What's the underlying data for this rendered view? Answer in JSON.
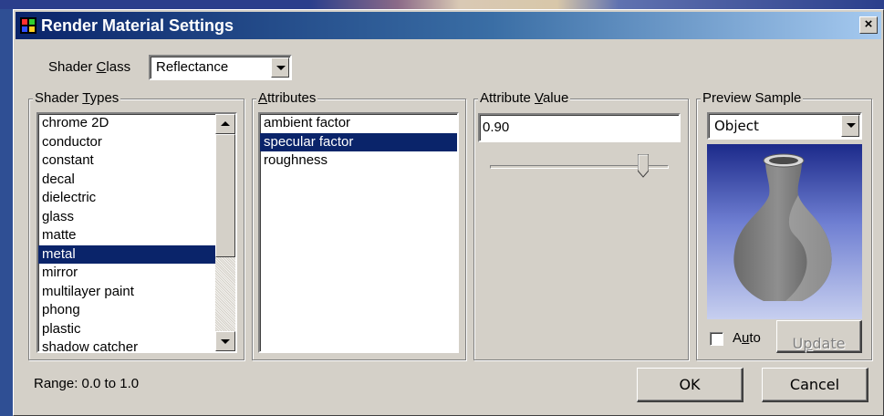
{
  "window": {
    "title": "Render Material Settings",
    "close_glyph": "×"
  },
  "shader_class": {
    "label_pre": "Shader ",
    "label_key": "C",
    "label_post": "lass",
    "value": "Reflectance"
  },
  "shader_types": {
    "legend_pre": "Shader ",
    "legend_key": "T",
    "legend_post": "ypes",
    "items": [
      "chrome 2D",
      "conductor",
      "constant",
      "decal",
      "dielectric",
      "glass",
      "matte",
      "metal",
      "mirror",
      "multilayer paint",
      "phong",
      "plastic",
      "shadow catcher"
    ],
    "selected": "metal"
  },
  "attributes": {
    "legend_key": "A",
    "legend_post": "ttributes",
    "items": [
      "ambient factor",
      "specular factor",
      "roughness"
    ],
    "selected": "specular factor"
  },
  "attribute_value": {
    "legend_pre": "Attribute ",
    "legend_key": "V",
    "legend_post": "alue",
    "value": "0.90",
    "slider_fraction": 0.9
  },
  "preview_sample": {
    "legend": "Preview Sample",
    "object_select": "Object",
    "auto_pre": "A",
    "auto_key": "u",
    "auto_post": "to",
    "auto_checked": false,
    "update_pre": "U",
    "update_key": "p",
    "update_post": "date"
  },
  "footer": {
    "range_text": "Range: 0.0 to 1.0",
    "ok_label": "OK",
    "cancel_label": "Cancel"
  },
  "icons": [
    "app-icon",
    "close-icon",
    "dropdown-arrow-icon",
    "scroll-up-icon",
    "scroll-down-icon",
    "slider-thumb-icon",
    "vase-preview-image"
  ],
  "colors": {
    "dialog_bg": "#d4d0c8",
    "title_start": "#0a246a",
    "title_end": "#a6caf0",
    "selection": "#0a246a"
  }
}
